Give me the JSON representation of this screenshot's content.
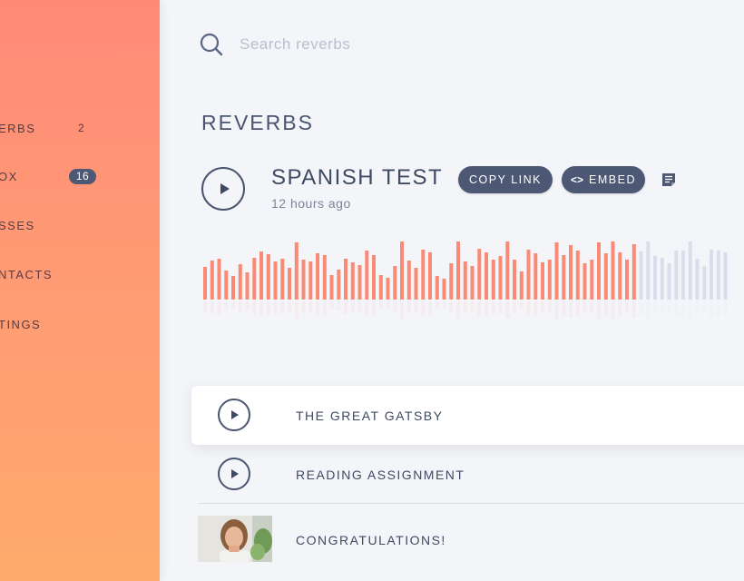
{
  "sidebar": {
    "items": [
      {
        "label": "ERBS",
        "count": "2",
        "style": "plain"
      },
      {
        "label": "OX",
        "count": "16",
        "style": "pill"
      },
      {
        "label": "SSES",
        "count": "",
        "style": "none"
      },
      {
        "label": "NTACTS",
        "count": "",
        "style": "none"
      },
      {
        "label": "TINGS",
        "count": "",
        "style": "none"
      }
    ],
    "gradient": [
      "#ff8a78",
      "#ffaa6c"
    ]
  },
  "search": {
    "placeholder": "Search reverbs",
    "value": ""
  },
  "main": {
    "section_title": "REVERBS",
    "featured": {
      "title": "SPANISH TEST",
      "time": "12 hours ago",
      "copy_label": "COPY LINK",
      "embed_label": "EMBED",
      "embed_icon": "<>",
      "progress_fraction": 0.83
    },
    "list": [
      {
        "title": "THE GREAT GATSBY",
        "kind": "audio"
      },
      {
        "title": "READING ASSIGNMENT",
        "kind": "audio"
      },
      {
        "title": "CONGRATULATIONS!",
        "kind": "video"
      }
    ]
  },
  "colors": {
    "accent": "#4d5874",
    "wave_played": "#f98b76",
    "wave_unplayed": "#dcdcea",
    "text": "#3e4a63"
  },
  "icons": [
    "search-icon",
    "play-icon",
    "notes-icon",
    "embed-code-icon"
  ]
}
